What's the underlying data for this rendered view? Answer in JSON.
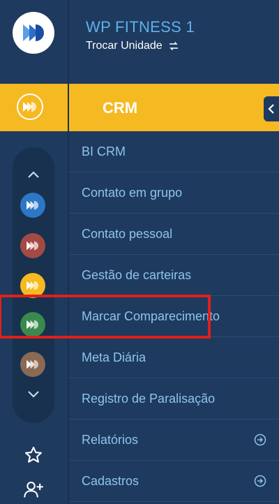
{
  "header": {
    "unit_name": "WP FITNESS 1",
    "switch_unit_label": "Trocar Unidade"
  },
  "rail": {
    "logo_icon": "pacto-logo-icon",
    "active_module_icon": "crm-module-icon",
    "scroll_up_icon": "chevron-up-icon",
    "scroll_down_icon": "chevron-down-icon",
    "units": [
      {
        "icon": "unit-icon",
        "color": "#2c78c4"
      },
      {
        "icon": "unit-icon",
        "color": "#a34a44"
      },
      {
        "icon": "unit-icon",
        "color": "#f5b921"
      },
      {
        "icon": "unit-icon",
        "color": "#3a8a4e"
      },
      {
        "icon": "unit-icon",
        "color": "#8a6a55"
      }
    ],
    "bottom_icons": [
      "star-icon",
      "add-user-icon"
    ]
  },
  "section": {
    "title": "CRM",
    "collapse_icon": "chevron-left-icon"
  },
  "menu": [
    {
      "label": "BI CRM",
      "has_arrow": false
    },
    {
      "label": "Contato em grupo",
      "has_arrow": false
    },
    {
      "label": "Contato pessoal",
      "has_arrow": false
    },
    {
      "label": "Gestão de carteiras",
      "has_arrow": false
    },
    {
      "label": "Marcar Comparecimento",
      "has_arrow": false,
      "highlighted": true
    },
    {
      "label": "Meta Diária",
      "has_arrow": false
    },
    {
      "label": "Registro de Paralisação",
      "has_arrow": false
    },
    {
      "label": "Relatórios",
      "has_arrow": true
    },
    {
      "label": "Cadastros",
      "has_arrow": true
    }
  ],
  "colors": {
    "background": "#1e3a5f",
    "accent": "#f5b921",
    "menu_text": "#8fc4ea",
    "title_text": "#5fb1e8",
    "highlight_border": "#e0201c"
  }
}
